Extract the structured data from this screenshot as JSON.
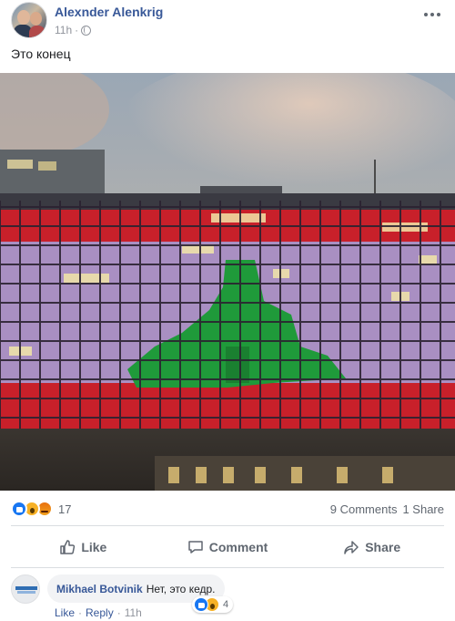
{
  "post": {
    "author": "Alexnder Alenkrig",
    "time": "11h",
    "separator": "·",
    "text": "Это конец"
  },
  "stats": {
    "reaction_count": "17",
    "comments": "9 Comments",
    "shares": "1 Share",
    "reaction_icons": [
      "like-icon",
      "wow-icon",
      "angry-icon"
    ]
  },
  "actions": {
    "like": "Like",
    "comment": "Comment",
    "share": "Share"
  },
  "comment": {
    "author": "Mikhael Botvinik",
    "text": "Нет, это кедр.",
    "like_label": "Like",
    "reply_label": "Reply",
    "time": "11h",
    "sep": "·",
    "reaction_count": "4"
  },
  "colors": {
    "link_blue": "#385898",
    "like_blue": "#1877f2",
    "muted": "#606770",
    "flag_red": "#d4202a",
    "flag_green": "#1f9a3a"
  }
}
